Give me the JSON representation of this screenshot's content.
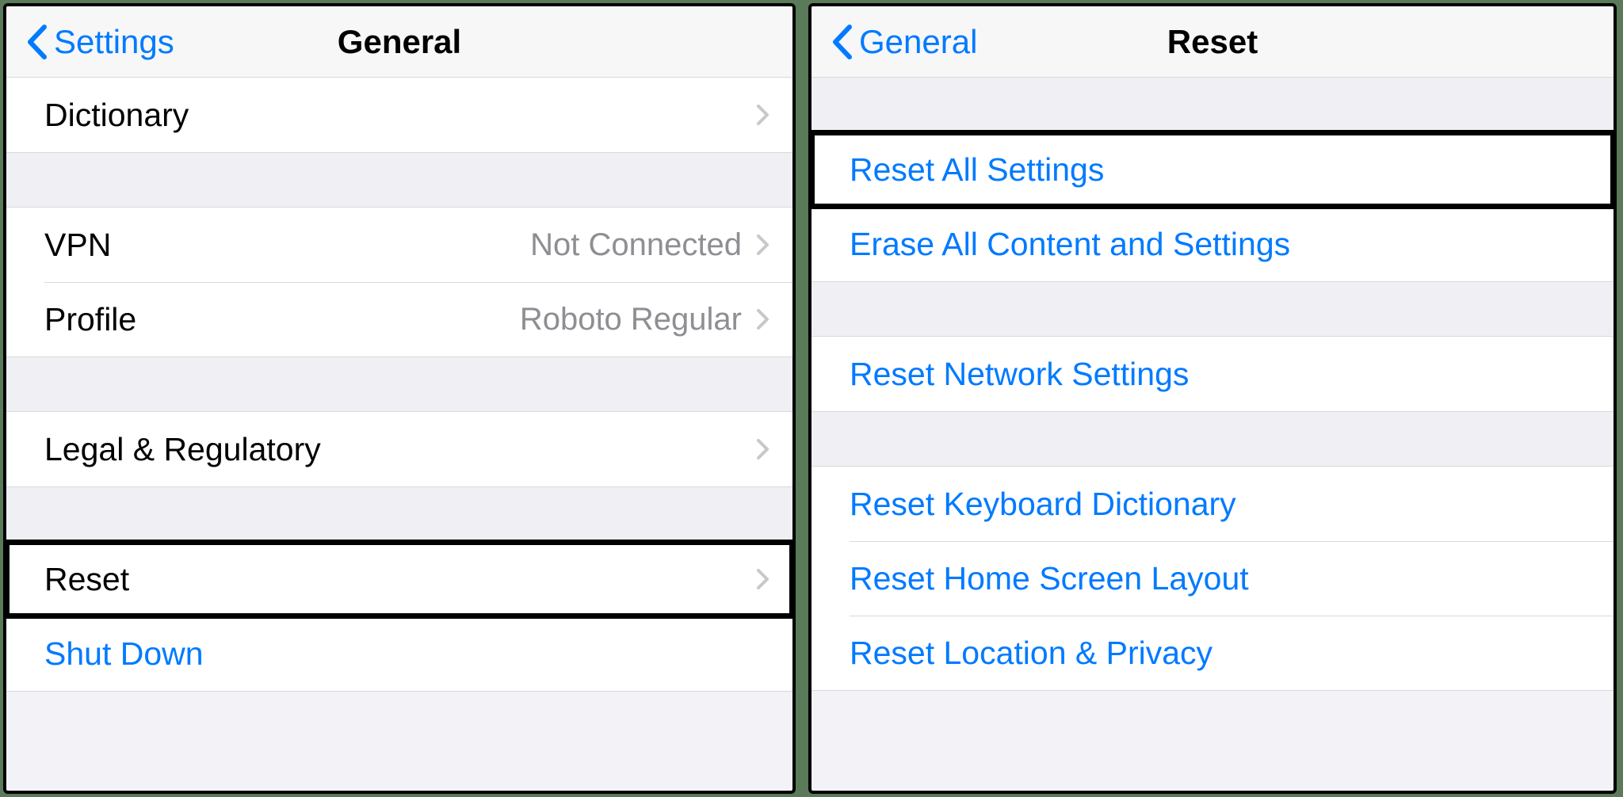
{
  "left": {
    "back_label": "Settings",
    "title": "General",
    "rows": {
      "dictionary": {
        "label": "Dictionary"
      },
      "vpn": {
        "label": "VPN",
        "detail": "Not Connected"
      },
      "profile": {
        "label": "Profile",
        "detail": "Roboto Regular"
      },
      "legal": {
        "label": "Legal & Regulatory"
      },
      "reset": {
        "label": "Reset"
      },
      "shutdown": {
        "label": "Shut Down"
      }
    }
  },
  "right": {
    "back_label": "General",
    "title": "Reset",
    "rows": {
      "reset_all": {
        "label": "Reset All Settings"
      },
      "erase_all": {
        "label": "Erase All Content and Settings"
      },
      "reset_network": {
        "label": "Reset Network Settings"
      },
      "reset_keyboard": {
        "label": "Reset Keyboard Dictionary"
      },
      "reset_home": {
        "label": "Reset Home Screen Layout"
      },
      "reset_location": {
        "label": "Reset Location & Privacy"
      }
    }
  },
  "colors": {
    "link": "#007aff",
    "secondary_text": "#8e8e93",
    "separator": "#d9d9dc",
    "group_bg": "#efeff4",
    "highlight_border": "#000000"
  }
}
